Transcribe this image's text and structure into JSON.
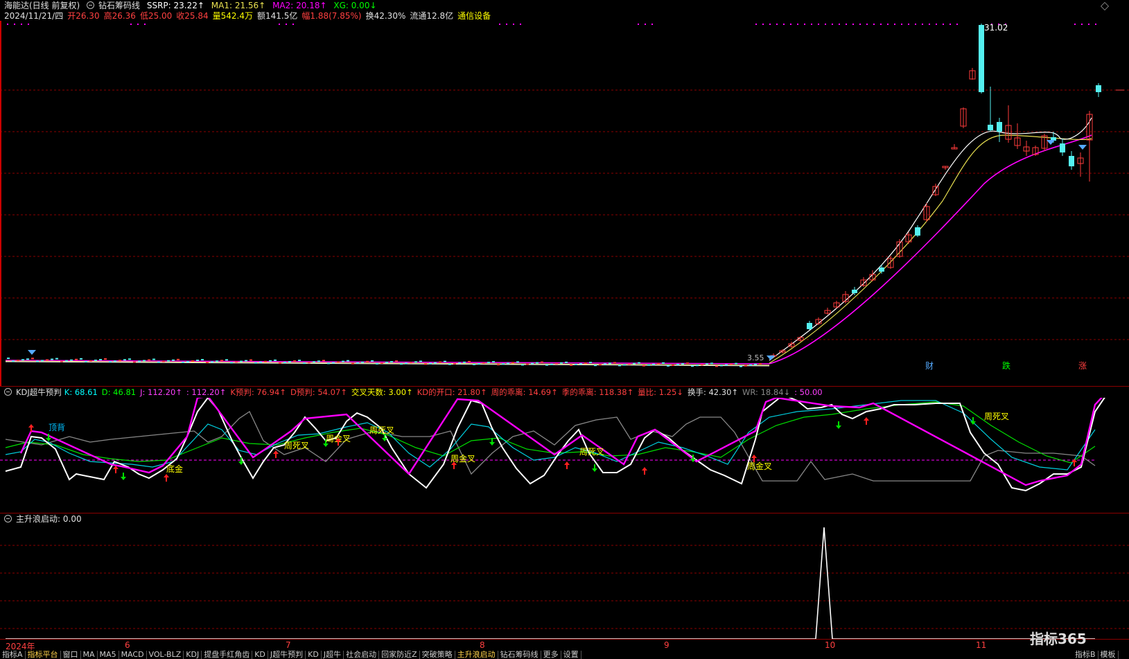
{
  "header": {
    "stock_name": "海能达(日线 前复权)",
    "indicator_name": "钻石筹码线",
    "ssrp": "SSRP: 23.22↑",
    "ma1": "MA1: 21.56↑",
    "ma2": "MA2: 20.18↑",
    "xg": "XG: 0.00↓"
  },
  "quote_line": {
    "date": "2024/11/21/四",
    "open": "开26.30",
    "high": "高26.36",
    "low": "低25.00",
    "close": "收25.84",
    "volume": "量542.4万",
    "amount": "额141.5亿",
    "change": "幅1.88(7.85%)",
    "turnover": "换42.30%",
    "float": "流通12.8亿",
    "sector": "通信设备"
  },
  "main_chart": {
    "max_label": "31.02",
    "min_label": "3.55",
    "markers": [
      "财",
      "跌",
      "涨"
    ]
  },
  "kdj_panel": {
    "title": "KDJ超牛预判",
    "k": "K: 68.61",
    "d": "D: 46.81",
    "j": "J: 112.20↑",
    "j2": ": 112.20↑",
    "k_pred": "K预判: 76.94↑",
    "d_pred": "D预判: 54.07↑",
    "cross_days": "交叉天数: 3.00↑",
    "kd_open": "KD的开口: 21.80↑",
    "week_dev": "周的乖离: 14.69↑",
    "season_dev": "季的乖离: 118.38↑",
    "vol_ratio": "量比: 1.25↓",
    "turnover": "换手: 42.30↑",
    "wr": "WR: 18.84↓",
    "fifty": ": 50.00",
    "labels": [
      {
        "text": "顶背",
        "color": "#00bfff"
      },
      {
        "text": "底金",
        "color": "#ffff00"
      },
      {
        "text": "周死叉",
        "color": "#ffff00"
      },
      {
        "text": "周金叉",
        "color": "#ffff00"
      },
      {
        "text": "周死叉",
        "color": "#ffff00"
      },
      {
        "text": "周金叉",
        "color": "#ffff00"
      },
      {
        "text": "周死叉",
        "color": "#ffff00"
      },
      {
        "text": "周金叉",
        "color": "#ffff00"
      },
      {
        "text": "周死叉",
        "color": "#ffff00"
      }
    ]
  },
  "wave_panel": {
    "title": "主升浪启动",
    "value": ": 0.00"
  },
  "x_axis": [
    "2024年",
    "6",
    "7",
    "8",
    "9",
    "10",
    "11"
  ],
  "tabs": [
    "指标A",
    "指标平台",
    "窗口",
    "MA",
    "MA5",
    "MACD",
    "VOL-BLZ",
    "KDJ",
    "提盘手红角齿",
    "KD",
    "J超牛预判",
    "KD",
    "J超牛",
    "社会启动",
    "回家防近Z",
    "突破策略",
    "主升浪启动",
    "钻石筹码线",
    "更多",
    "设置"
  ],
  "tabs_right": [
    "指标B",
    "模板"
  ],
  "logo": "指标365",
  "colors": {
    "up": "#ff3b3b",
    "down": "#54f0f0",
    "ssrp": "#ffffff",
    "ma1": "#e8e050",
    "ma2": "#ff00ff",
    "grid": "#8b0000"
  }
}
